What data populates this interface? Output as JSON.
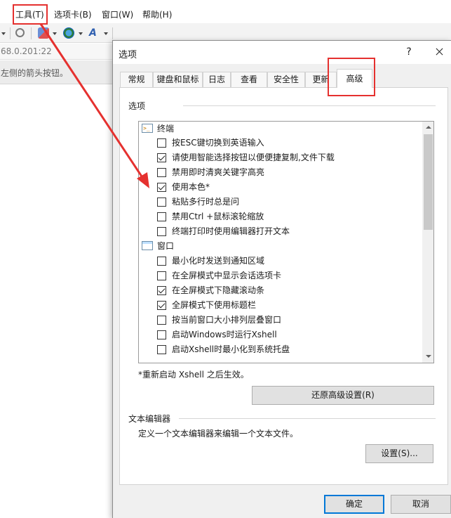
{
  "app": {
    "menu": [
      "工具(T)",
      "选项卡(B)",
      "窗口(W)",
      "帮助(H)"
    ],
    "address_text": "68.0.201:22",
    "hint_text": "左侧的箭头按钮。"
  },
  "dialog": {
    "title": "选项",
    "help_label": "?",
    "tabs": [
      "常规",
      "键盘和鼠标",
      "日志",
      "查看",
      "安全性",
      "更新",
      "高级"
    ],
    "active_tab": "高级",
    "options_group": "选项",
    "categories": [
      {
        "label": "终端",
        "icon": "terminal-icon",
        "items": [
          {
            "label": "按ESC键切换到英语输入",
            "checked": false
          },
          {
            "label": "请使用智能选择按钮以便便捷复制,文件下载",
            "checked": true
          },
          {
            "label": "禁用即时清爽关键字高亮",
            "checked": false
          },
          {
            "label": "使用本色*",
            "checked": true
          },
          {
            "label": "粘贴多行时总是问",
            "checked": false
          },
          {
            "label": "禁用Ctrl +鼠标滚轮缩放",
            "checked": false
          },
          {
            "label": "终端打印时使用编辑器打开文本",
            "checked": false
          }
        ]
      },
      {
        "label": "窗口",
        "icon": "window-icon",
        "items": [
          {
            "label": "最小化时发送到通知区域",
            "checked": false
          },
          {
            "label": "在全屏模式中显示会话选项卡",
            "checked": false
          },
          {
            "label": "在全屏模式下隐藏滚动条",
            "checked": true
          },
          {
            "label": "全屏模式下使用标题栏",
            "checked": true
          },
          {
            "label": "按当前窗口大小排列层叠窗口",
            "checked": false
          },
          {
            "label": "启动Windows时运行Xshell",
            "checked": false
          },
          {
            "label": "启动Xshell时最小化到系统托盘",
            "checked": false
          }
        ]
      }
    ],
    "restart_note": "*重新启动 Xshell 之后生效。",
    "restore_button": "还原高级设置(R)",
    "editor_group": "文本编辑器",
    "editor_desc": "定义一个文本编辑器来编辑一个文本文件。",
    "settings_button": "设置(S)...",
    "ok_button": "确定",
    "cancel_button": "取消"
  },
  "colors": {
    "highlight": "#e5312f",
    "primary_border": "#0078d7"
  }
}
